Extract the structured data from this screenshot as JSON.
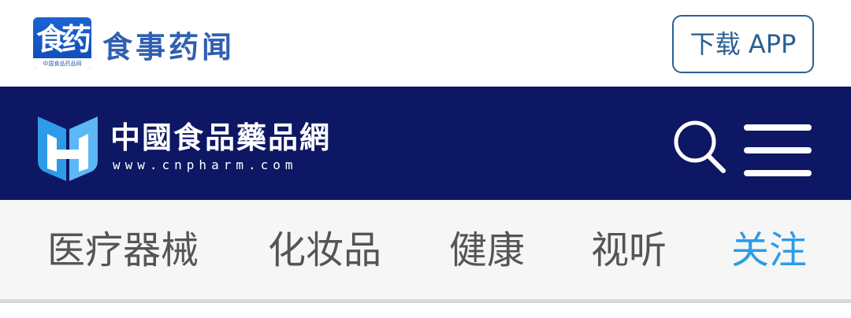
{
  "header": {
    "app_logo_text": "食药",
    "app_logo_subtext": "中国食品药品网",
    "app_name": "食事药闻",
    "download_label": "下载 APP"
  },
  "nav": {
    "site_name": "中國食品藥品網",
    "site_url": "www.cnpharm.com",
    "icons": [
      "search-icon",
      "menu-icon"
    ]
  },
  "tabs": [
    {
      "label": "医疗器械",
      "active": false
    },
    {
      "label": "化妆品",
      "active": false
    },
    {
      "label": "健康",
      "active": false
    },
    {
      "label": "视听",
      "active": false
    },
    {
      "label": "关注",
      "active": true
    }
  ],
  "colors": {
    "nav_background": "#0d1763",
    "active_tab": "#2b9de5",
    "tab_text": "#555555",
    "brand_blue": "#2f5fb0"
  }
}
